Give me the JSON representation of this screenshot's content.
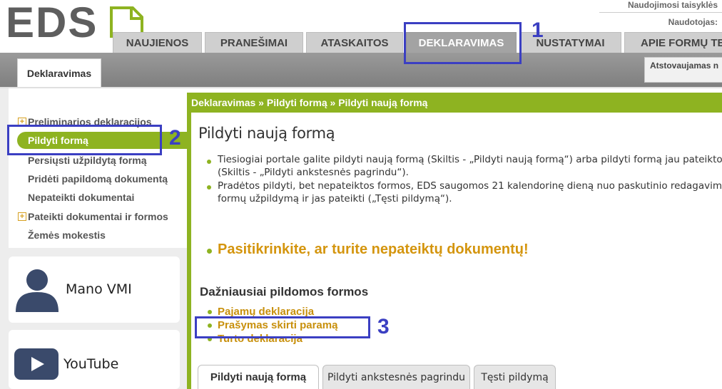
{
  "header": {
    "logo_text": "EDS",
    "top_links": [
      "Naudojimosi taisyklės",
      "Naudotojas:"
    ],
    "tabs": [
      "NAUJIENOS",
      "PRANEŠIMAI",
      "ATASKAITOS",
      "DEKLARAVIMAS",
      "NUSTATYMAI",
      "APIE FORMŲ TEIKIMĄ"
    ],
    "active_tab": "DEKLARAVIMAS",
    "subtab": "Deklaravimas",
    "representing_label": "Atstovaujamas n"
  },
  "sidebar": {
    "items": [
      {
        "label": "Preliminarios deklaracijos",
        "expandable": true
      },
      {
        "label": "Pildyti formą",
        "active": true
      },
      {
        "label": "Persiųsti užpildytą formą"
      },
      {
        "label": "Pridėti papildomą dokumentą"
      },
      {
        "label": "Nepateikti dokumentai"
      },
      {
        "label": "Pateikti dokumentai ir formos",
        "expandable": true
      },
      {
        "label": "Žemės mokestis"
      }
    ],
    "expand_symbol": "+",
    "cards": [
      {
        "label": "Mano VMI",
        "icon": "user-icon"
      },
      {
        "label": "YouTube",
        "icon": "play-icon"
      }
    ]
  },
  "main": {
    "breadcrumb": "Deklaravimas » Pildyti formą » Pildyti naują formą",
    "title": "Pildyti naują formą",
    "paragraphs": [
      {
        "line1": "Tiesiogiai portale galite pildyti naują formą (Skiltis - „Pildyti naują formą“) arba pildyti formą jau pateiktos",
        "line2": "(Skiltis - „Pildyti ankstesnės pagrindu“)."
      },
      {
        "line1": "Pradėtos pildyti, bet nepateiktos formos, EDS saugomos 21 kalendorinę dieną nuo paskutinio redagavimo",
        "line2": "formų užpildymą ir jas pateikti („Tęsti pildymą“)."
      }
    ],
    "alert": "Pasitikrinkite, ar turite nepateiktų dokumentų!",
    "frequent_heading": "Dažniausiai pildomos formos",
    "frequent_forms": [
      "Pajamų deklaracija",
      "Prašymas skirti paramą",
      "Turto deklaracija"
    ],
    "bottom_tabs": [
      "Pildyti naują formą",
      "Pildyti ankstesnės pagrindu",
      "Tęsti pildymą"
    ],
    "active_bottom_tab": "Pildyti naują formą"
  },
  "annotations": [
    "1",
    "2",
    "3"
  ],
  "colors": {
    "accent_green": "#8eb321",
    "link_orange": "#c8900c",
    "annotation_blue": "#3b3fc2"
  }
}
